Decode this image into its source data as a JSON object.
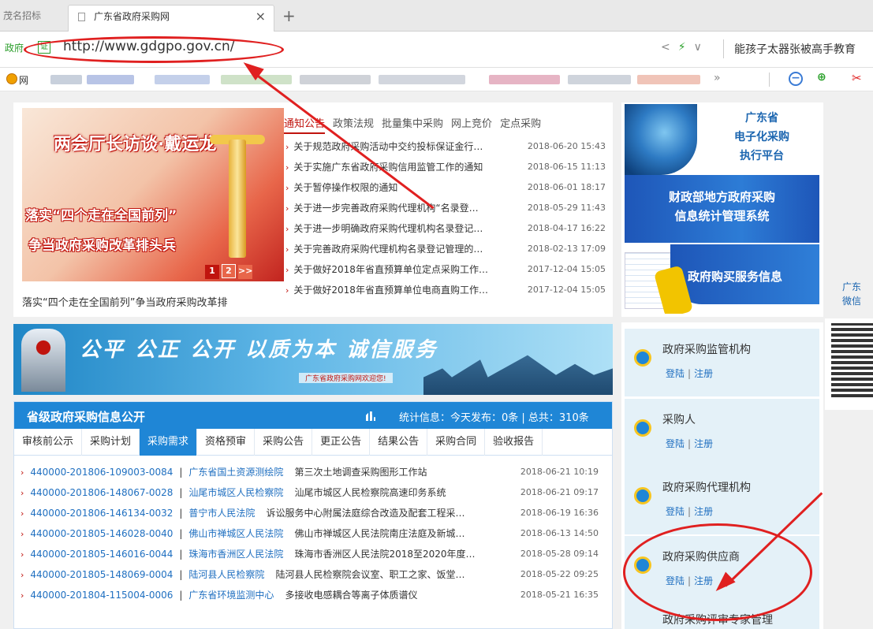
{
  "browser": {
    "prev_tab": "茂名招标",
    "current_tab": "广东省政府采购网",
    "close_icon": "×",
    "new_tab_icon": "+",
    "address_prefix": "政府",
    "address_badge": "证",
    "url": "http://www.gdgpo.gov.cn/",
    "search_text": "能孩子太器张被高手教育",
    "bookmark_label": "网"
  },
  "news": {
    "banner_title": "两会厅长访谈·戴运龙",
    "banner_line2": "落实“四个走在全国前列”",
    "banner_line3": "争当政府采购改革排头兵",
    "pager": [
      "1",
      "2",
      ">>"
    ],
    "banner_caption": "落实“四个走在全国前列”争当政府采购改革排",
    "tabs": [
      "通知公告",
      "政策法规",
      "批量集中采购",
      "网上竞价",
      "定点采购"
    ],
    "items": [
      {
        "title": "关于规范政府采购活动中交约投标保证金行…",
        "date": "2018-06-20 15:43"
      },
      {
        "title": "关于实施广东省政府采购信用监管工作的通知",
        "date": "2018-06-15 11:13"
      },
      {
        "title": "关于暂停操作权限的通知",
        "date": "2018-06-01 18:17"
      },
      {
        "title": "关于进一步完善政府采购代理机构“名录登…",
        "date": "2018-05-29 11:43"
      },
      {
        "title": "关于进一步明确政府采购代理机构名录登记…",
        "date": "2018-04-17 16:22"
      },
      {
        "title": "关于完善政府采购代理机构名录登记管理的…",
        "date": "2018-02-13 17:09"
      },
      {
        "title": "关于做好2018年省直预算单位定点采购工作…",
        "date": "2017-12-04 15:05"
      },
      {
        "title": "关于做好2018年省直预算单位电商直购工作…",
        "date": "2017-12-04 15:05"
      }
    ]
  },
  "platforms": {
    "p1": "广东省\n电子化采购\n执行平台",
    "p2": "财政部地方政府采购\n信息统计管理系统",
    "p3": "政府购买服务信息",
    "qr_label": "广东\n微信"
  },
  "banner2": {
    "slogan": "公平 公正 公开  以质为本 诚信服务",
    "sub": "广东省政府采购网欢迎您!"
  },
  "info": {
    "title": "省级政府采购信息公开",
    "stats": "统计信息：今天发布：0条 | 总共：310条",
    "tabs": [
      "审核前公示",
      "采购计划",
      "采购需求",
      "资格预审",
      "采购公告",
      "更正公告",
      "结果公告",
      "采购合同",
      "验收报告"
    ],
    "items": [
      {
        "code": "440000-201806-109003-0084",
        "unit": "广东省国土资源测绘院",
        "title": "第三次土地调查采购图形工作站",
        "date": "2018-06-21 10:19"
      },
      {
        "code": "440000-201806-148067-0028",
        "unit": "汕尾市城区人民检察院",
        "title": "汕尾市城区人民检察院高速印务系统",
        "date": "2018-06-21 09:17"
      },
      {
        "code": "440000-201806-146134-0032",
        "unit": "普宁市人民法院",
        "title": "诉讼服务中心附属法庭综合改造及配套工程采…",
        "date": "2018-06-19 16:36"
      },
      {
        "code": "440000-201805-146028-0040",
        "unit": "佛山市禅城区人民法院",
        "title": "佛山市禅城区人民法院南庄法庭及新城…",
        "date": "2018-06-13 14:50"
      },
      {
        "code": "440000-201805-146016-0044",
        "unit": "珠海市香洲区人民法院",
        "title": "珠海市香洲区人民法院2018至2020年度…",
        "date": "2018-05-28 09:14"
      },
      {
        "code": "440000-201805-148069-0004",
        "unit": "陆河县人民检察院",
        "title": "陆河县人民检察院会议室、职工之家、饭堂…",
        "date": "2018-05-22 09:25"
      },
      {
        "code": "440000-201804-115004-0006",
        "unit": "广东省环境监测中心",
        "title": "多接收电感耦合等离子体质谱仪",
        "date": "2018-05-21 16:35"
      }
    ]
  },
  "login": {
    "link_login": "登陆",
    "link_sep": "|",
    "link_register": "注册",
    "cards": [
      "政府采购监管机构",
      "采购人",
      "政府采购代理机构",
      "政府采购供应商",
      "政府采购评审专家管理"
    ]
  },
  "colors": {
    "accent_red": "#c0140e",
    "brand_blue": "#1f86d6",
    "annotation_red": "#e02020"
  }
}
